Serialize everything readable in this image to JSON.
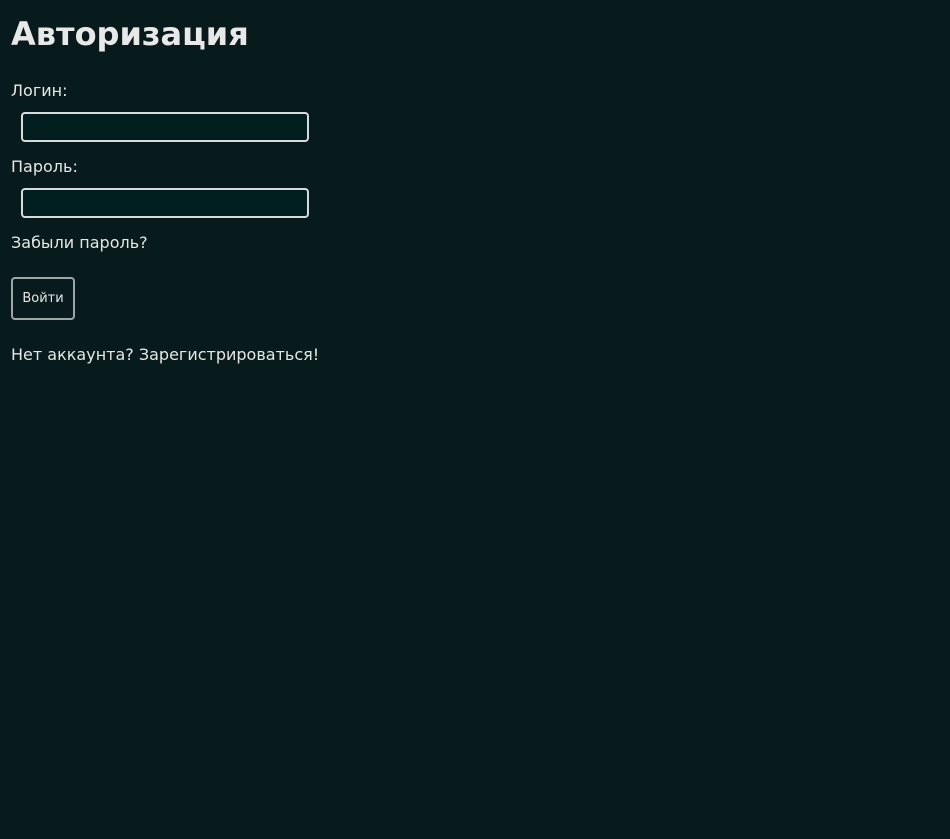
{
  "page": {
    "title": "Авторизация"
  },
  "login_form": {
    "login_label": "Логин:",
    "login_value": "",
    "password_label": "Пароль:",
    "password_value": "",
    "forgot_password_link": "Забыли пароль?",
    "submit_label": "Войти",
    "register_prompt": "Нет аккаунта? Зарегистрироваться!"
  }
}
